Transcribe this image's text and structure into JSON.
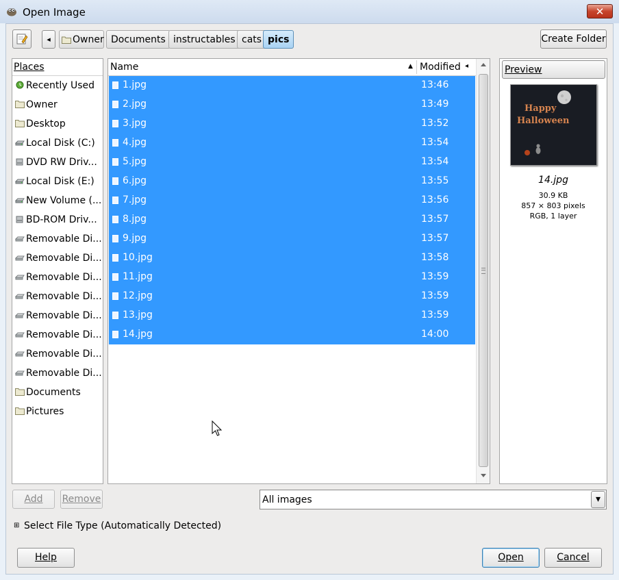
{
  "window": {
    "title": "Open Image",
    "close_glyph": "✕"
  },
  "toolbar": {
    "edit_icon": "pencil-icon",
    "back_glyph": "◂",
    "create_folder": "Create Folder"
  },
  "path": [
    "Owner",
    "Documents",
    "instructables",
    "cats",
    "pics"
  ],
  "places": {
    "header": "Places",
    "items": [
      {
        "label": "Recently Used",
        "icon": "recent-icon"
      },
      {
        "label": "Owner",
        "icon": "folder-icon"
      },
      {
        "label": "Desktop",
        "icon": "folder-icon"
      },
      {
        "label": "Local Disk (C:)",
        "icon": "disk-icon"
      },
      {
        "label": "DVD RW Driv...",
        "icon": "optical-drive-icon"
      },
      {
        "label": "Local Disk (E:)",
        "icon": "disk-icon"
      },
      {
        "label": "New Volume (...",
        "icon": "disk-icon"
      },
      {
        "label": "BD-ROM Driv...",
        "icon": "optical-drive-icon"
      },
      {
        "label": "Removable Di...",
        "icon": "removable-disk-icon"
      },
      {
        "label": "Removable Di...",
        "icon": "removable-disk-icon"
      },
      {
        "label": "Removable Di...",
        "icon": "removable-disk-icon"
      },
      {
        "label": "Removable Di...",
        "icon": "removable-disk-icon"
      },
      {
        "label": "Removable Di...",
        "icon": "removable-disk-icon"
      },
      {
        "label": "Removable Di...",
        "icon": "removable-disk-icon"
      },
      {
        "label": "Removable Di...",
        "icon": "removable-disk-icon"
      },
      {
        "label": "Removable Di...",
        "icon": "removable-disk-icon"
      },
      {
        "label": "Documents",
        "icon": "folder-icon"
      },
      {
        "label": "Pictures",
        "icon": "folder-icon"
      }
    ],
    "add": "Add",
    "remove": "Remove"
  },
  "files": {
    "col_name": "Name",
    "col_modified": "Modified",
    "sort_glyph": "▲",
    "col_menu_glyph": "◂",
    "rows": [
      {
        "name": "1.jpg",
        "modified": "13:46"
      },
      {
        "name": "2.jpg",
        "modified": "13:49"
      },
      {
        "name": "3.jpg",
        "modified": "13:52"
      },
      {
        "name": "4.jpg",
        "modified": "13:54"
      },
      {
        "name": "5.jpg",
        "modified": "13:54"
      },
      {
        "name": "6.jpg",
        "modified": "13:55"
      },
      {
        "name": "7.jpg",
        "modified": "13:56"
      },
      {
        "name": "8.jpg",
        "modified": "13:57"
      },
      {
        "name": "9.jpg",
        "modified": "13:57"
      },
      {
        "name": "10.jpg",
        "modified": "13:58"
      },
      {
        "name": "11.jpg",
        "modified": "13:59"
      },
      {
        "name": "12.jpg",
        "modified": "13:59"
      },
      {
        "name": "13.jpg",
        "modified": "13:59"
      },
      {
        "name": "14.jpg",
        "modified": "14:00"
      }
    ],
    "selection_color": "#3399ff"
  },
  "preview": {
    "header": "Preview",
    "image_text_1": "Happy",
    "image_text_2": "Halloween",
    "filename": "14.jpg",
    "size": "30.9 KB",
    "dimensions": "857 × 803 pixels",
    "mode": "RGB, 1 layer"
  },
  "filter": {
    "value": "All images",
    "arrow": "▾"
  },
  "filetype": {
    "expander": "⊞",
    "label": "Select File Type (Automatically Detected)"
  },
  "buttons": {
    "help": "Help",
    "open": "Open",
    "cancel": "Cancel"
  }
}
